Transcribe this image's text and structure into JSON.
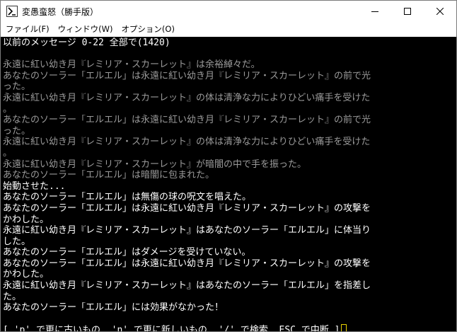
{
  "window": {
    "title": "変愚蛮怒（勝手版）"
  },
  "menu": {
    "items": [
      {
        "label": "ファイル(F)"
      },
      {
        "label": "ウィンドウ(W)"
      },
      {
        "label": "オプション(O)"
      }
    ]
  },
  "console": {
    "header": "以前のメッセージ 0-22 全部で(1420)",
    "lines": [
      "",
      "永遠に紅い幼き月『レミリア・スカーレット』は余裕綽々だ。",
      "あなたのソーラー「エルエル」は永遠に紅い幼き月『レミリア・スカーレット』の前で光",
      "った。",
      "永遠に紅い幼き月『レミリア・スカーレット』の体は清浄な力によりひどい痛手を受けた",
      "。",
      "あなたのソーラー「エルエル」は永遠に紅い幼き月『レミリア・スカーレット』の前で光",
      "った。",
      "永遠に紅い幼き月『レミリア・スカーレット』の体は清浄な力によりひどい痛手を受けた",
      "。",
      "永遠に紅い幼き月『レミリア・スカーレット』が暗闇の中で手を振った。",
      "あなたのソーラー「エルエル」は暗闇に包まれた。",
      "始動させた...",
      "あなたのソーラー「エルエル」は無傷の球の呪文を唱えた。",
      "あなたのソーラー「エルエル」は永遠に紅い幼き月『レミリア・スカーレット』の攻撃を",
      "かわした。",
      "永遠に紅い幼き月『レミリア・スカーレット』はあなたのソーラー「エルエル」に体当り",
      "した。",
      "あなたのソーラー「エルエル」はダメージを受けていない。",
      "あなたのソーラー「エルエル」は永遠に紅い幼き月『レミリア・スカーレット』の攻撃を",
      "かわした。",
      "永遠に紅い幼き月『レミリア・スカーレット』はあなたのソーラー「エルエル」を指差し",
      "た。",
      "あなたのソーラー「エルエル」には効果がなかった！",
      ""
    ],
    "prompt": "[ 'p' で更に古いもの, 'n' で更に新しいもの, '/' で検索, ESC で中断 ]"
  },
  "colors": {
    "console_bg": "#000000",
    "old_message": "#9a9a9a",
    "new_message": "#ffffff",
    "cursor": "#e8d200"
  },
  "icons": {
    "app": "hengband-app-icon",
    "minimize": "minimize-icon",
    "maximize": "maximize-icon",
    "close": "close-icon"
  }
}
